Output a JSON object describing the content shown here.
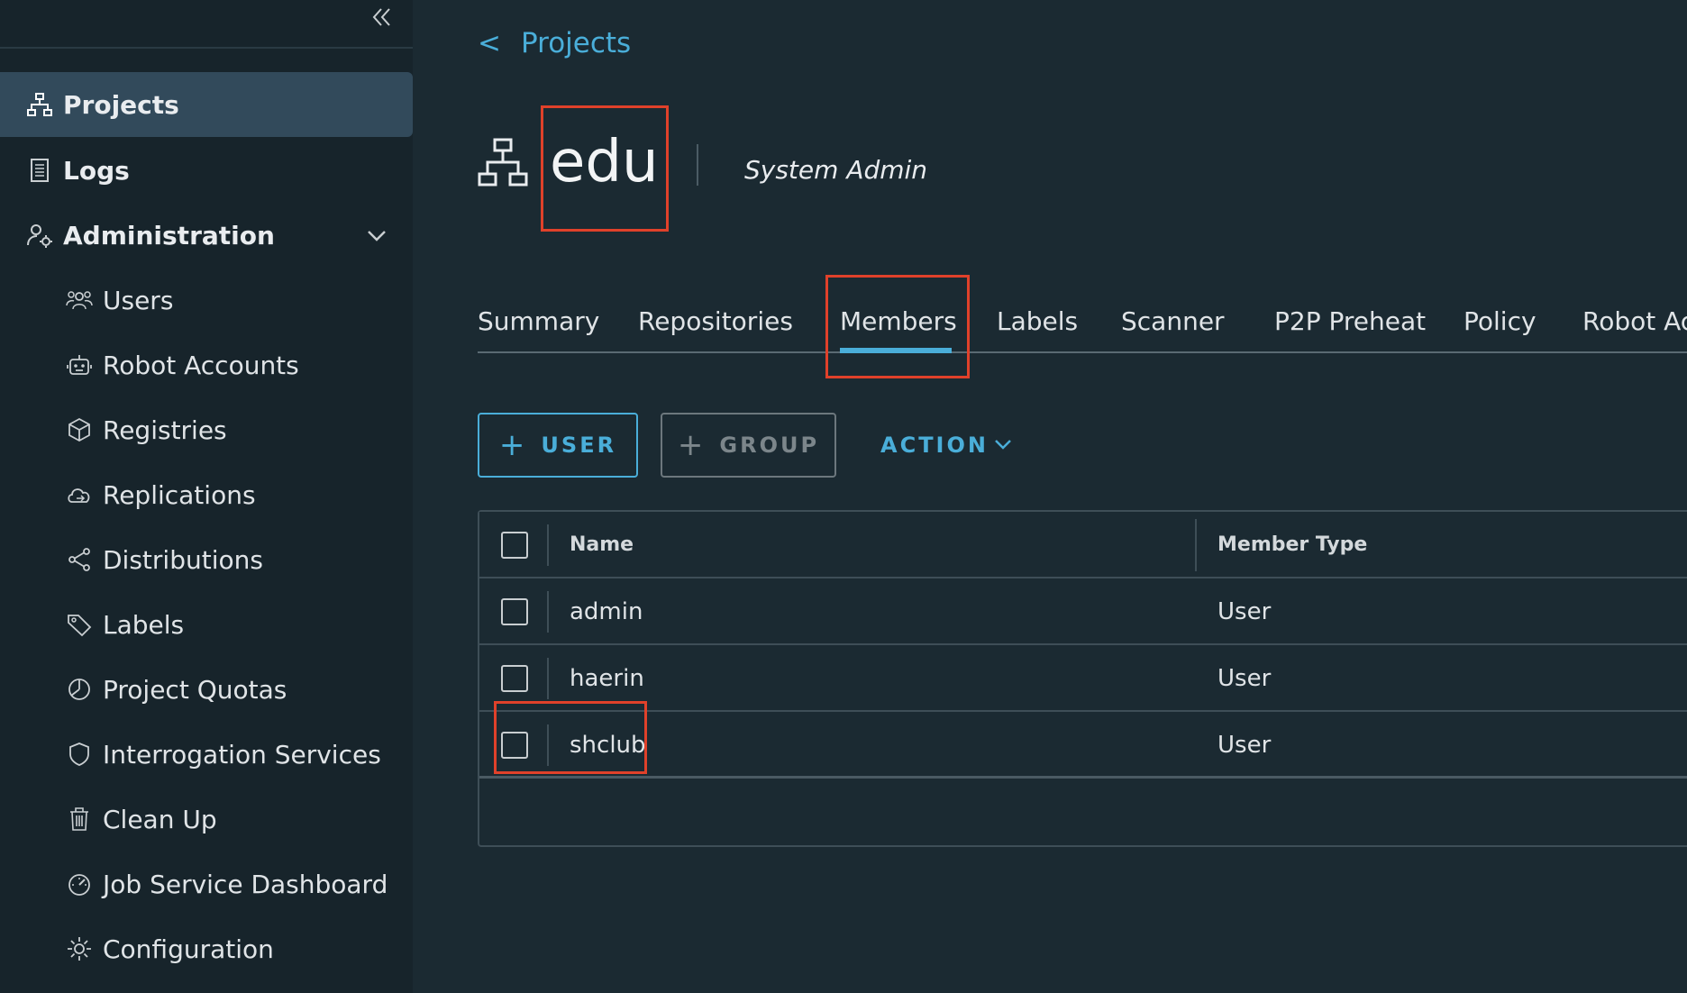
{
  "sidebar": {
    "collapse_icon": "double-chevron-left-icon",
    "items": [
      {
        "label": "Projects",
        "icon": "projects-icon",
        "active": true
      },
      {
        "label": "Logs",
        "icon": "logs-icon"
      },
      {
        "label": "Administration",
        "icon": "admin-icon",
        "expanded": true
      }
    ],
    "admin_items": [
      {
        "label": "Users",
        "icon": "users-icon"
      },
      {
        "label": "Robot Accounts",
        "icon": "robot-icon"
      },
      {
        "label": "Registries",
        "icon": "registries-icon"
      },
      {
        "label": "Replications",
        "icon": "replications-icon"
      },
      {
        "label": "Distributions",
        "icon": "distributions-icon"
      },
      {
        "label": "Labels",
        "icon": "labels-icon"
      },
      {
        "label": "Project Quotas",
        "icon": "quotas-icon"
      },
      {
        "label": "Interrogation Services",
        "icon": "shield-icon"
      },
      {
        "label": "Clean Up",
        "icon": "trash-icon"
      },
      {
        "label": "Job Service Dashboard",
        "icon": "dashboard-icon"
      },
      {
        "label": "Configuration",
        "icon": "gear-icon"
      }
    ]
  },
  "breadcrumb": {
    "back": "<",
    "label": "Projects"
  },
  "project": {
    "name": "edu",
    "role": "System Admin"
  },
  "tabs": [
    {
      "label": "Summary"
    },
    {
      "label": "Repositories"
    },
    {
      "label": "Members",
      "active": true
    },
    {
      "label": "Labels"
    },
    {
      "label": "Scanner"
    },
    {
      "label": "P2P Preheat"
    },
    {
      "label": "Policy"
    },
    {
      "label": "Robot Ac"
    }
  ],
  "toolbar": {
    "user_plus": "+",
    "user_label": "USER",
    "group_plus": "+",
    "group_label": "GROUP",
    "action_label": "ACTION"
  },
  "table": {
    "columns": [
      "Name",
      "Member Type"
    ],
    "rows": [
      {
        "name": "admin",
        "type": "User"
      },
      {
        "name": "haerin",
        "type": "User"
      },
      {
        "name": "shclub",
        "type": "User"
      }
    ]
  },
  "colors": {
    "accent": "#4aaed9",
    "highlight": "#e0412a",
    "background": "#1b2a32",
    "sidebar": "#17242b"
  }
}
